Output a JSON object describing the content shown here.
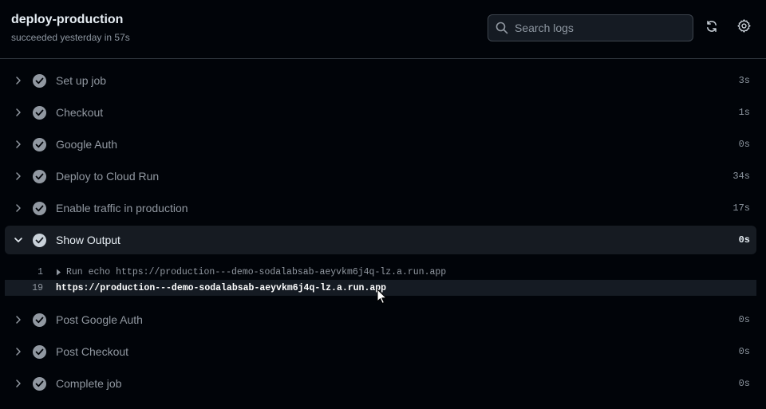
{
  "header": {
    "title": "deploy-production",
    "subtitle": "succeeded yesterday in 57s",
    "search": {
      "placeholder": "Search logs",
      "value": ""
    },
    "icons": {
      "search": "search-icon",
      "refresh": "sync-icon",
      "settings": "gear-icon"
    }
  },
  "steps_before": [
    {
      "name": "Set up job",
      "duration": "3s"
    },
    {
      "name": "Checkout",
      "duration": "1s"
    },
    {
      "name": "Google Auth",
      "duration": "0s"
    },
    {
      "name": "Deploy to Cloud Run",
      "duration": "34s"
    },
    {
      "name": "Enable traffic in production",
      "duration": "17s"
    }
  ],
  "expanded_step": {
    "name": "Show Output",
    "duration": "0s",
    "log": [
      {
        "line": "1",
        "text": "Run echo https://production---demo-sodalabsab-aeyvkm6j4q-lz.a.run.app"
      },
      {
        "line": "19",
        "text": "https://production---demo-sodalabsab-aeyvkm6j4q-lz.a.run.app"
      }
    ]
  },
  "steps_after": [
    {
      "name": "Post Google Auth",
      "duration": "0s"
    },
    {
      "name": "Post Checkout",
      "duration": "0s"
    },
    {
      "name": "Complete job",
      "duration": "0s"
    }
  ],
  "colors": {
    "background": "#010409",
    "border": "#30363d",
    "success_icon": "#9198a1",
    "text": "#e6edf3"
  }
}
